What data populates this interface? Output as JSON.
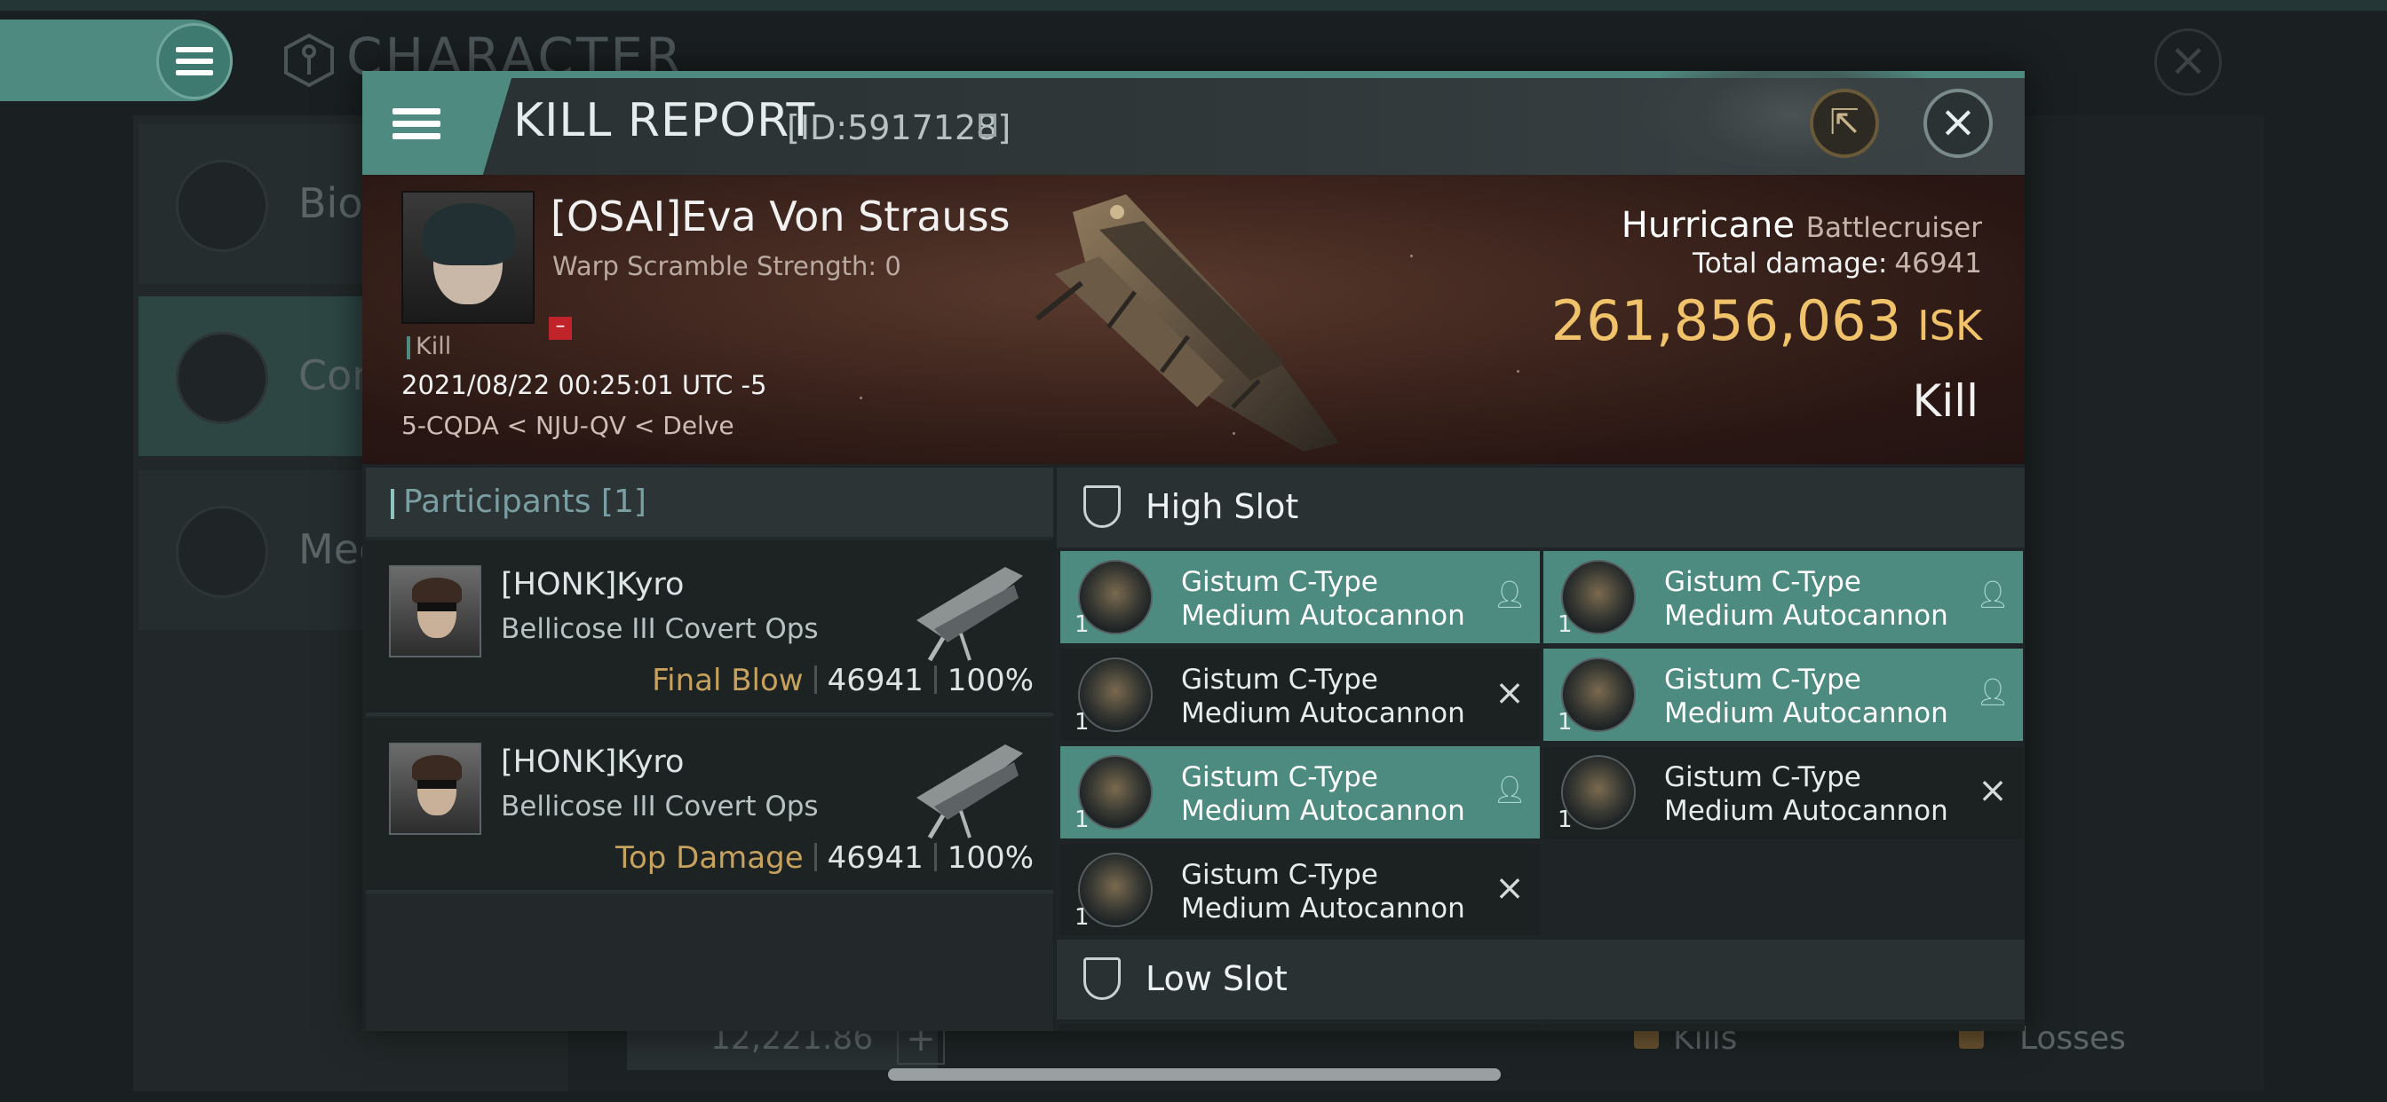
{
  "background": {
    "title": "CHARACTER",
    "tabs": [
      {
        "label": "Bio",
        "icon": "list-icon"
      },
      {
        "label": "Con",
        "icon": "crossed-swords-icon"
      },
      {
        "label": "Med",
        "icon": "star-badge-icon"
      }
    ],
    "bottom": {
      "wallet_value": "12,221.86",
      "kills_label": "Kills",
      "losses_label": "Losses"
    }
  },
  "modal": {
    "title": "KILL REPORT",
    "id_text": "[ID:5917128]",
    "victim": {
      "name": "[OSAI]Eva Von Strauss",
      "warp_scramble": "Warp Scramble Strength: 0",
      "tag": "Kill",
      "datetime": "2021/08/22 00:25:01 UTC -5",
      "location": "5-CQDA < NJU-QV < Delve"
    },
    "ship": {
      "name": "Hurricane",
      "class": "Battlecruiser",
      "total_damage_label": "Total damage:",
      "total_damage_value": "46941",
      "isk_value": "261,856,063",
      "isk_unit": "ISK",
      "result": "Kill"
    },
    "participants": {
      "title": "Participants [1]",
      "rows": [
        {
          "name": "[HONK]Kyro",
          "ship": "Bellicose III Covert Ops",
          "tag": "Final Blow",
          "damage": "46941",
          "percent": "100%"
        },
        {
          "name": "[HONK]Kyro",
          "ship": "Bellicose III Covert Ops",
          "tag": "Top Damage",
          "damage": "46941",
          "percent": "100%"
        }
      ]
    },
    "slots": {
      "high_label": "High Slot",
      "low_label": "Low Slot",
      "high_modules": [
        {
          "line1": "Gistum C-Type",
          "line2": "Medium Autocannon",
          "qty": "1",
          "status": "dropped"
        },
        {
          "line1": "Gistum C-Type",
          "line2": "Medium Autocannon",
          "qty": "1",
          "status": "dropped"
        },
        {
          "line1": "Gistum C-Type",
          "line2": "Medium Autocannon",
          "qty": "1",
          "status": "destroyed"
        },
        {
          "line1": "Gistum C-Type",
          "line2": "Medium Autocannon",
          "qty": "1",
          "status": "dropped"
        },
        {
          "line1": "Gistum C-Type",
          "line2": "Medium Autocannon",
          "qty": "1",
          "status": "dropped"
        },
        {
          "line1": "Gistum C-Type",
          "line2": "Medium Autocannon",
          "qty": "1",
          "status": "destroyed"
        },
        {
          "line1": "Gistum C-Type",
          "line2": "Medium Autocannon",
          "qty": "1",
          "status": "destroyed"
        }
      ]
    }
  },
  "colors": {
    "accent": "#4f8a80",
    "isk": "#f0c26a",
    "tag_gold": "#c7a15e",
    "destroyed_flag": "#c0242a"
  },
  "icons": {
    "status_dropped": "person-icon",
    "status_destroyed": "x-icon"
  }
}
